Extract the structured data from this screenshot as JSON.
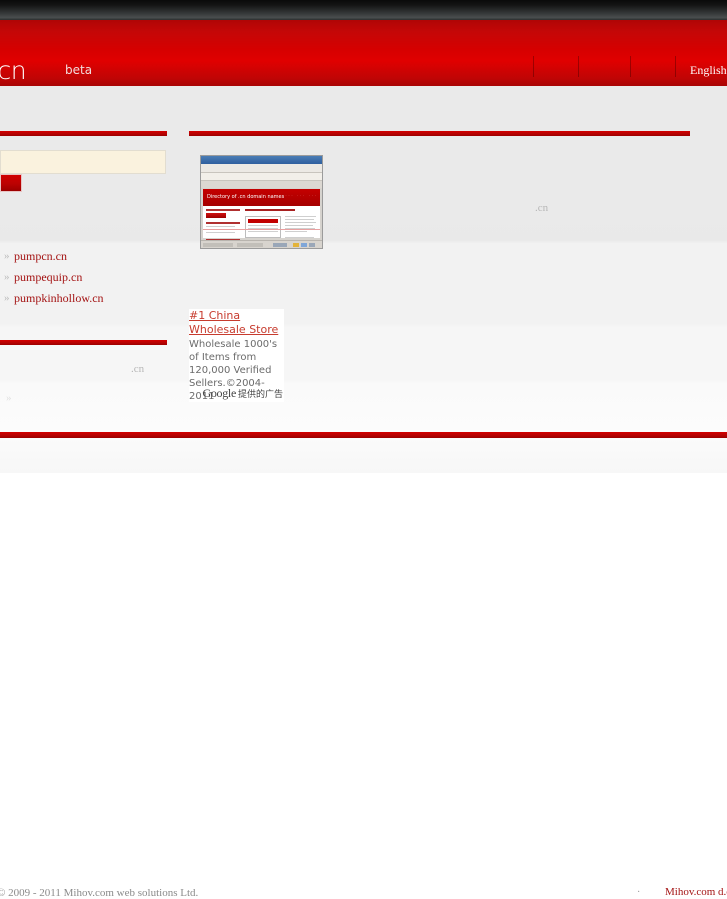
{
  "header": {
    "logo": ".cn",
    "beta_label": "beta",
    "nav": [
      {
        "label": "English",
        "name": "nav-english"
      }
    ]
  },
  "search": {
    "value": "",
    "placeholder": "",
    "button_label": ""
  },
  "results": {
    "items": [
      {
        "bullet": "»",
        "domain": "pumpcn.cn"
      },
      {
        "bullet": "»",
        "domain": "pumpequip.cn"
      },
      {
        "bullet": "»",
        "domain": "pumpkinhollow.cn"
      }
    ],
    "trailing_bullet": "»"
  },
  "faint_text": {
    "main_cn": ".cn",
    "lower_cn": ".cn"
  },
  "thumbnail": {
    "site_title": "Directory of .cn domain names",
    "nav_hint": "···   ···   ···"
  },
  "ad": {
    "title_line1": "#1 China",
    "title_line2": "Wholesale Store",
    "body": "Wholesale 1000's of Items from 120,000 Verified Sellers.©2004-2011",
    "brand": "Google",
    "brand_suffix": "提供的广告"
  },
  "footer": {
    "copyright": "© 2009 - 2011 Mihov.com web solutions Ltd.",
    "dot": "·",
    "link": "Mihov.com d.o.o."
  },
  "colors": {
    "brand_red": "#d60000",
    "link_red": "#a41414",
    "ad_title_red": "#c73b2e",
    "input_cream": "#faf2de"
  }
}
